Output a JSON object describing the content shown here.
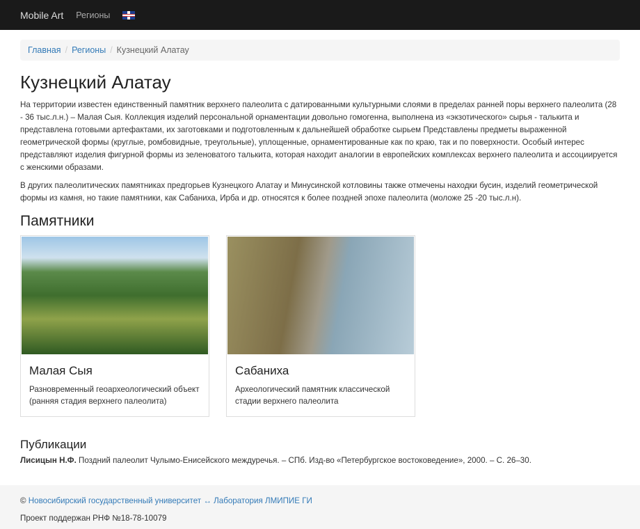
{
  "nav": {
    "brand": "Mobile Art",
    "regions": "Регионы",
    "language_icon": "uk-flag"
  },
  "breadcrumb": [
    "Главная",
    "Регионы",
    "Кузнецкий Алатау"
  ],
  "title": "Кузнецкий Алатау",
  "paragraphs": [
    "На территории известен единственный памятник верхнего палеолита с датированными культурными слоями в пределах ранней поры верхнего палеолита (28 - 36 тыс.л.н.) – Малая Сыя. Коллекция изделий персональной орнаментации довольно гомогенна, выполнена из «экзотического» сырья - талькита и представлена готовыми артефактами, их заготовками и подготовленным к дальнейшей обработке сырьем Представлены предметы выраженной геометрической формы (круглые, ромбовидные, треугольные), уплощенные, орнаментированные как по краю, так и по поверхности. Особый интерес представляют изделия фигурной формы из зеленоватого талькита, которая находит аналогии в европейских комплексах верхнего палеолита и ассоциируется с женскими образами.",
    "В других палеолитических памятниках предгорьев Кузнецкого Алатау и Минусинской котловины также отмечены находки бусин, изделий геометрической формы из камня, но такие памятники, как Сабаниха, Ирба и др. относятся к более поздней эпохе палеолита (моложе 25 -20 тыс.л.н)."
  ],
  "monuments_heading": "Памятники",
  "cards": [
    {
      "title": "Малая Сыя",
      "desc": "Разновременный геоархеологический объект (ранняя стадия верхнего палеолита)"
    },
    {
      "title": "Сабаниха",
      "desc": "Археологический памятник классической стадии верхнего палеолита"
    }
  ],
  "publications_heading": "Публикации",
  "publication": {
    "author": "Лисицын Н.Ф.",
    "text": " Поздний палеолит Чулымо-Енисейского междуречья. – СПб. Изд-во  «Петербургское востоковедение», 2000. – С. 26–30."
  },
  "footer": {
    "copyright": "© ",
    "university": "Новосибирский государственный университет",
    "arrow": " ↔ ",
    "lab": "Лаборатория ЛМИПИЕ ГИ",
    "grant": "Проект поддержан РНФ №18-78-10079"
  }
}
